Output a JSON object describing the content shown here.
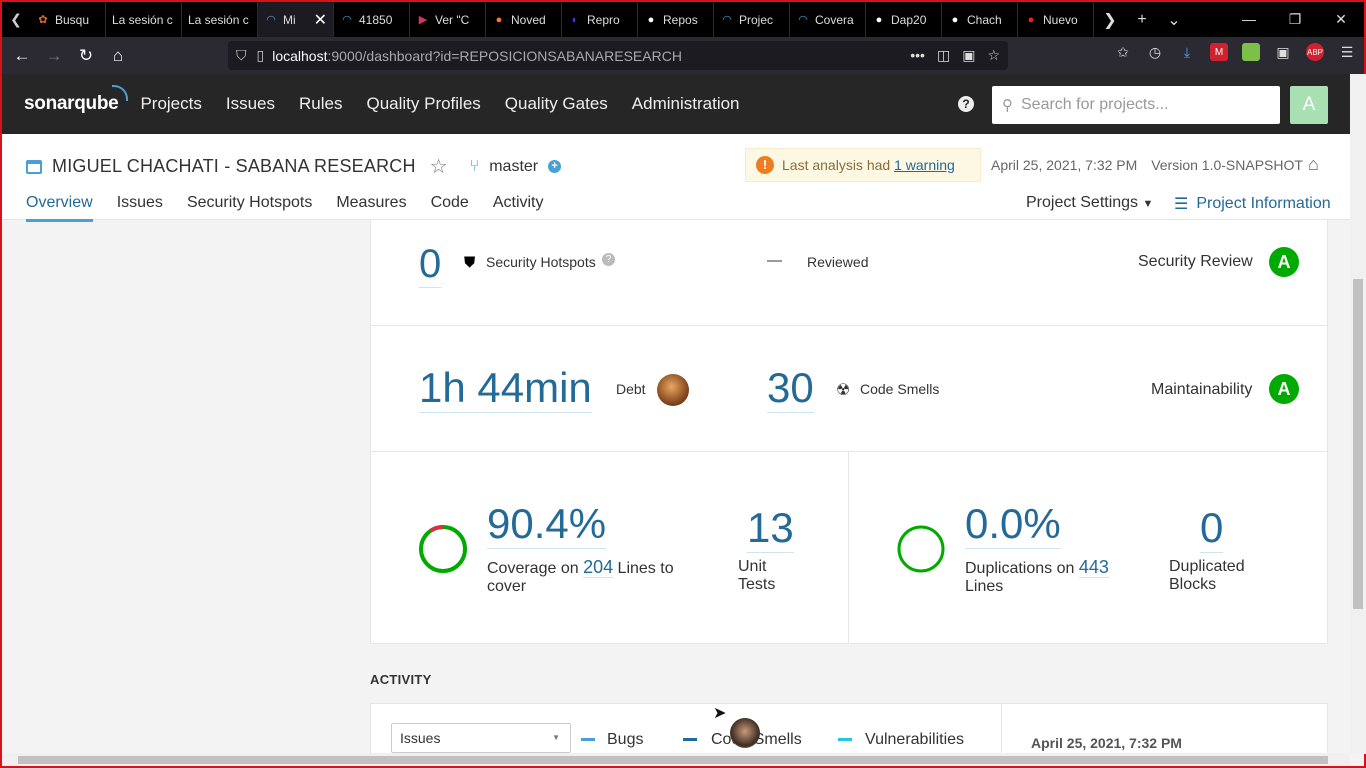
{
  "browser": {
    "tabs": [
      {
        "label": "Busqu",
        "icon": "app-icon",
        "color": "#e8652b"
      },
      {
        "label": "La sesión c",
        "icon": "",
        "color": ""
      },
      {
        "label": "La sesión c",
        "icon": "",
        "color": ""
      },
      {
        "label": "Mi",
        "icon": "sonar-icon",
        "color": "#4b9fd5",
        "active": true
      },
      {
        "label": "41850",
        "icon": "sonar-icon",
        "color": "#4b9fd5"
      },
      {
        "label": "Ver \"C",
        "icon": "play-icon",
        "color": "#d6336c"
      },
      {
        "label": "Noved",
        "icon": "firefox-icon",
        "color": "#ff7139"
      },
      {
        "label": "Repro",
        "icon": "deezer-icon",
        "color": "#3b3bff"
      },
      {
        "label": "Repos",
        "icon": "github-icon",
        "color": "#ffffff"
      },
      {
        "label": "Projec",
        "icon": "sonar-icon",
        "color": "#4b9fd5"
      },
      {
        "label": "Covera",
        "icon": "sonar-icon",
        "color": "#4b9fd5"
      },
      {
        "label": "Dap20",
        "icon": "github-icon",
        "color": "#ffffff"
      },
      {
        "label": "Chach",
        "icon": "github-icon",
        "color": "#ffffff"
      },
      {
        "label": "Nuevo",
        "icon": "mic-icon",
        "color": "#e22"
      }
    ],
    "url_host": "localhost",
    "url_rest": ":9000/dashboard?id=REPOSICIONSABANARESEARCH"
  },
  "sonar_nav": {
    "logo": "sonarqube",
    "items": [
      "Projects",
      "Issues",
      "Rules",
      "Quality Profiles",
      "Quality Gates",
      "Administration"
    ],
    "search_placeholder": "Search for projects...",
    "avatar_letter": "A",
    "help": "?"
  },
  "project": {
    "title": "MIGUEL CHACHATI - SABANA RESEARCH",
    "branch": "master",
    "warning_prefix": "Last analysis had ",
    "warning_link": "1 warning",
    "date": "April 25, 2021, 7:32 PM",
    "version": "Version 1.0-SNAPSHOT",
    "tabs": [
      "Overview",
      "Issues",
      "Security Hotspots",
      "Measures",
      "Code",
      "Activity"
    ],
    "settings": "Project Settings",
    "info": "Project Information"
  },
  "hotspots": {
    "value": "0",
    "label": "Security Hotspots",
    "reviewed_value": "—",
    "reviewed_label": "Reviewed",
    "rating_label": "Security Review",
    "rating": "A"
  },
  "maintainability": {
    "debt_value": "1h 44min",
    "debt_label": "Debt",
    "smells_value": "30",
    "smells_label": "Code Smells",
    "rating_label": "Maintainability",
    "rating": "A"
  },
  "coverage": {
    "value": "90.4%",
    "coverage_ratio": 0.904,
    "on_text": "Coverage on ",
    "lines": "204",
    "lines_text": " Lines to cover",
    "unit_tests": "13",
    "unit_tests_label": "Unit Tests"
  },
  "duplications": {
    "value": "0.0%",
    "on_text": "Duplications on ",
    "lines": "443",
    "lines_text": " Lines",
    "blocks": "0",
    "blocks_label": "Duplicated Blocks"
  },
  "activity": {
    "heading": "ACTIVITY",
    "select_value": "Issues",
    "legend": [
      "Bugs",
      "Code Smells",
      "Vulnerabilities"
    ],
    "date": "April 25, 2021, 7:32 PM"
  },
  "colors": {
    "accent": "#236a97",
    "rating_a": "#00aa00",
    "header_bg": "#262626"
  }
}
